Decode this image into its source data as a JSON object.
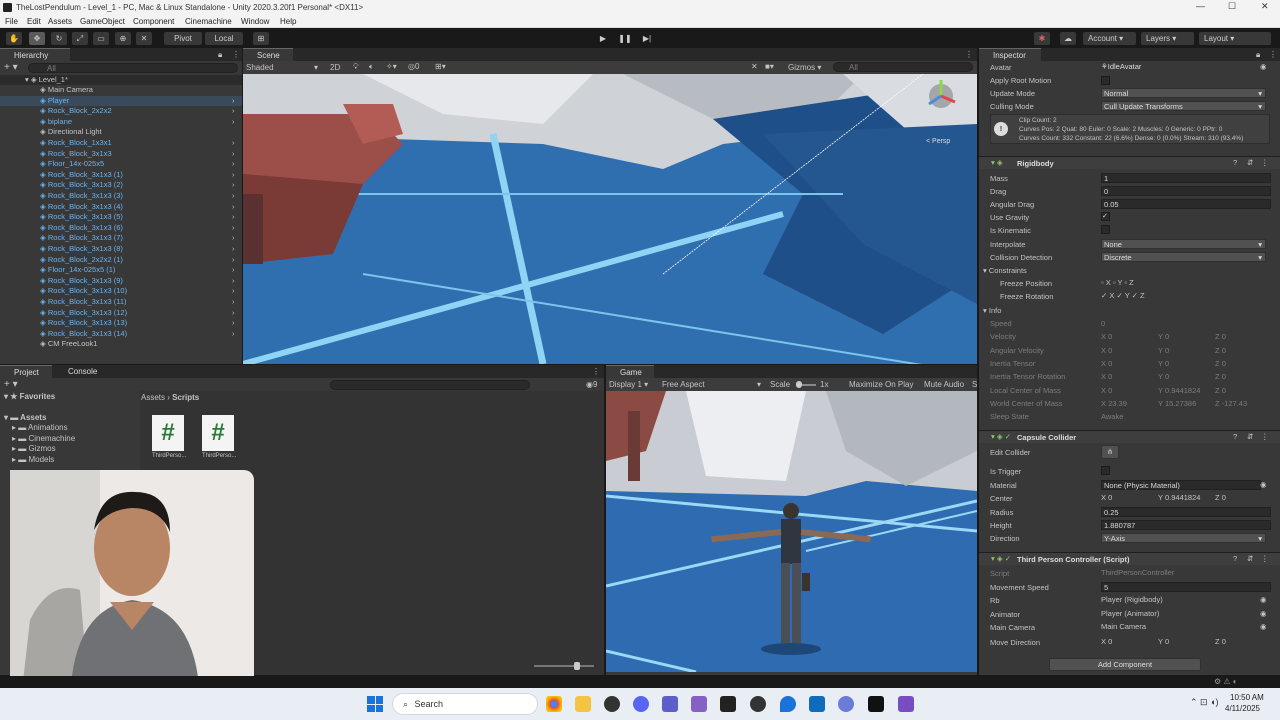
{
  "window": {
    "title": "TheLostPendulum - Level_1 - PC, Mac & Linux Standalone - Unity 2020.3.20f1 Personal* <DX11>"
  },
  "menu": [
    "File",
    "Edit",
    "Assets",
    "GameObject",
    "Component",
    "Cinemachine",
    "Window",
    "Help"
  ],
  "toolbar": {
    "pivot": "Pivot",
    "local": "Local",
    "account": "Account",
    "layers": "Layers",
    "layout": "Layout"
  },
  "hierarchy": {
    "tab": "Hierarchy",
    "search": "All",
    "scene": "Level_1*",
    "items": [
      {
        "label": "Main Camera",
        "blue": false
      },
      {
        "label": "Player",
        "blue": true
      },
      {
        "label": "Rock_Block_2x2x2",
        "blue": true
      },
      {
        "label": "biplane",
        "blue": true
      },
      {
        "label": "Directional Light",
        "blue": false
      },
      {
        "label": "Rock_Block_1x3x1",
        "blue": true
      },
      {
        "label": "Rock_Block_3x1x3",
        "blue": true
      },
      {
        "label": "Floor_14x-025x5",
        "blue": true
      },
      {
        "label": "Rock_Block_3x1x3 (1)",
        "blue": true
      },
      {
        "label": "Rock_Block_3x1x3 (2)",
        "blue": true
      },
      {
        "label": "Rock_Block_3x1x3 (3)",
        "blue": true
      },
      {
        "label": "Rock_Block_3x1x3 (4)",
        "blue": true
      },
      {
        "label": "Rock_Block_3x1x3 (5)",
        "blue": true
      },
      {
        "label": "Rock_Block_3x1x3 (6)",
        "blue": true
      },
      {
        "label": "Rock_Block_3x1x3 (7)",
        "blue": true
      },
      {
        "label": "Rock_Block_3x1x3 (8)",
        "blue": true
      },
      {
        "label": "Rock_Block_2x2x2 (1)",
        "blue": true
      },
      {
        "label": "Floor_14x-025x5 (1)",
        "blue": true
      },
      {
        "label": "Rock_Block_3x1x3 (9)",
        "blue": true
      },
      {
        "label": "Rock_Block_3x1x3 (10)",
        "blue": true
      },
      {
        "label": "Rock_Block_3x1x3 (11)",
        "blue": true
      },
      {
        "label": "Rock_Block_3x1x3 (12)",
        "blue": true
      },
      {
        "label": "Rock_Block_3x1x3 (13)",
        "blue": true
      },
      {
        "label": "Rock_Block_3x1x3 (14)",
        "blue": true
      },
      {
        "label": "CM FreeLook1",
        "blue": false
      }
    ]
  },
  "scene": {
    "tab": "Scene",
    "shading": "Shaded",
    "mode2d": "2D",
    "gizmos": "Gizmos",
    "search": "All",
    "persp": "< Persp",
    "layers_count": "0"
  },
  "project": {
    "tab": "Project",
    "console": "Console",
    "favorites": "Favorites",
    "assets": "Assets",
    "folders": [
      "Animations",
      "Cinemachine",
      "Gizmos",
      "Models"
    ],
    "breadcrumb": [
      "Assets",
      "Scripts"
    ],
    "files": [
      "ThirdPerso...",
      "ThirdPerso..."
    ],
    "count": "9"
  },
  "game": {
    "tab": "Game",
    "display": "Display 1",
    "aspect": "Free Aspect",
    "scale_label": "Scale",
    "scale": "1x",
    "maximize": "Maximize On Play",
    "mute": "Mute Audio",
    "stats": "S"
  },
  "inspector": {
    "tab": "Inspector",
    "animator": [
      {
        "label": "Avatar",
        "value": "IdleAvatar"
      },
      {
        "label": "Apply Root Motion",
        "value": ""
      },
      {
        "label": "Update Mode",
        "value": "Normal"
      },
      {
        "label": "Culling Mode",
        "value": "Cull Update Transforms"
      }
    ],
    "info_lines": [
      "Clip Count: 2",
      "Curves Pos: 2 Quat: 80 Euler: 0 Scale: 2 Muscles: 0 Generic: 0 PPtr: 0",
      "Curves Count: 332 Constant: 22 (6.6%) Dense: 0 (0.0%) Stream: 310 (93.4%)"
    ],
    "rigidbody": {
      "title": "Rigidbody",
      "fields": [
        {
          "label": "Mass",
          "value": "1"
        },
        {
          "label": "Drag",
          "value": "0"
        },
        {
          "label": "Angular Drag",
          "value": "0.05"
        }
      ],
      "use_gravity": "Use Gravity",
      "is_kinematic": "Is Kinematic",
      "interpolate": {
        "label": "Interpolate",
        "value": "None"
      },
      "collision": {
        "label": "Collision Detection",
        "value": "Discrete"
      },
      "constraints": "Constraints",
      "freeze_pos": "Freeze Position",
      "freeze_rot": "Freeze Rotation",
      "info": "Info",
      "info_rows": [
        {
          "label": "Speed",
          "x": "0",
          "y": "",
          "z": ""
        },
        {
          "label": "Velocity",
          "x": "0",
          "y": "0",
          "z": "0"
        },
        {
          "label": "Angular Velocity",
          "x": "0",
          "y": "0",
          "z": "0"
        },
        {
          "label": "Inertia Tensor",
          "x": "0",
          "y": "0",
          "z": "0"
        },
        {
          "label": "Inertia Tensor Rotation",
          "x": "0",
          "y": "0",
          "z": "0"
        },
        {
          "label": "Local Center of Mass",
          "x": "0",
          "y": "0.9441824",
          "z": "0"
        },
        {
          "label": "World Center of Mass",
          "x": "23.39",
          "y": "15.27386",
          "z": "-127.43"
        }
      ],
      "sleep": {
        "label": "Sleep State",
        "value": "Awake"
      }
    },
    "capsule": {
      "title": "Capsule Collider",
      "edit": "Edit Collider",
      "trigger": "Is Trigger",
      "material": {
        "label": "Material",
        "value": "None (Physic Material)"
      },
      "center": {
        "label": "Center",
        "x": "0",
        "y": "0.9441824",
        "z": "0"
      },
      "radius": {
        "label": "Radius",
        "value": "0.25"
      },
      "height": {
        "label": "Height",
        "value": "1.880787"
      },
      "direction": {
        "label": "Direction",
        "value": "Y-Axis"
      }
    },
    "script": {
      "title": "Third Person Controller (Script)",
      "rows": [
        {
          "label": "Script",
          "value": "ThirdPersonController"
        },
        {
          "label": "Movement Speed",
          "value": "5"
        },
        {
          "label": "Rb",
          "value": "Player (Rigidbody)"
        },
        {
          "label": "Animator",
          "value": "Player (Animator)"
        },
        {
          "label": "Main Camera",
          "value": "Main Camera"
        }
      ],
      "move_dir": {
        "label": "Move Direction",
        "x": "0",
        "y": "0",
        "z": "0"
      }
    },
    "add_component": "Add Component",
    "axis": {
      "x": "X",
      "y": "Y",
      "z": "Z"
    }
  },
  "taskbar": {
    "search": "Search",
    "time": "10:50 AM",
    "date": "4/11/2025"
  }
}
